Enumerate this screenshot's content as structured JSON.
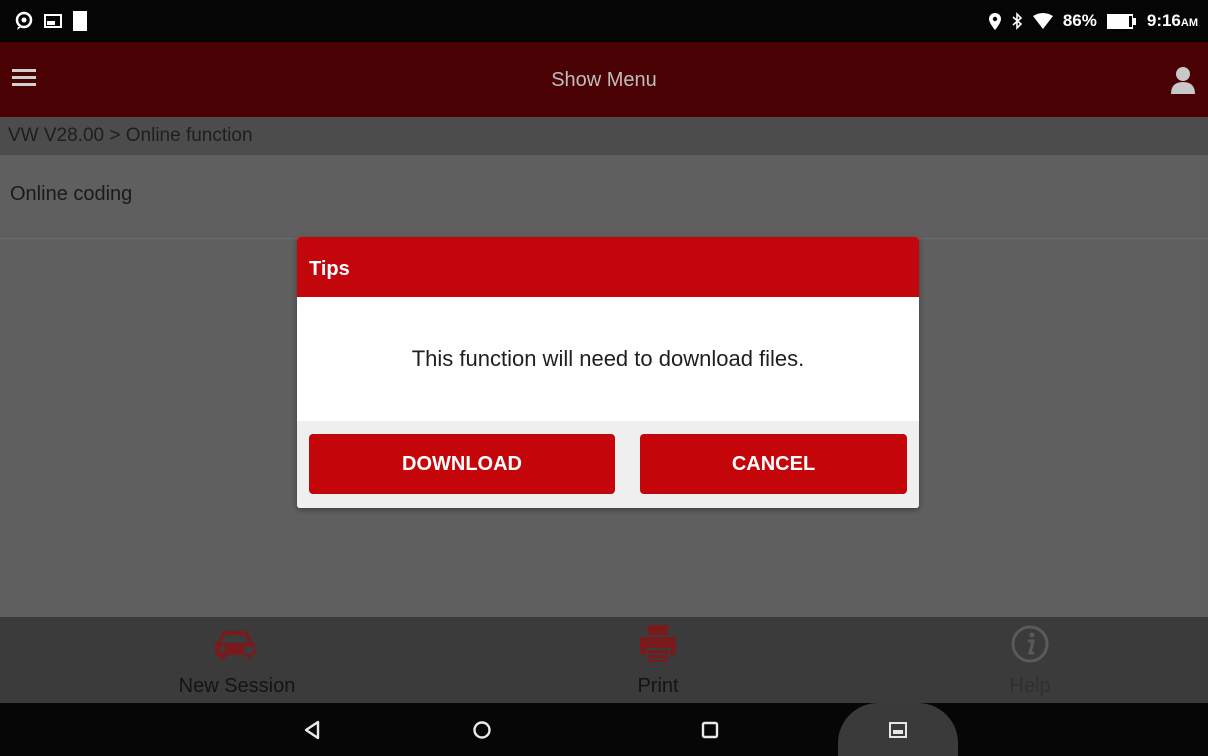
{
  "status_bar": {
    "battery": "86%",
    "time": "9:16",
    "ampm": "AM"
  },
  "app_bar": {
    "title": "Show Menu"
  },
  "breadcrumb": "VW V28.00 > Online function",
  "content": {
    "items": [
      {
        "label": "Online coding"
      }
    ]
  },
  "dialog": {
    "title": "Tips",
    "message": "This function will need to download files.",
    "download_label": "DOWNLOAD",
    "cancel_label": "CANCEL"
  },
  "toolbar": {
    "new_session_label": "New Session",
    "print_label": "Print",
    "help_label": "Help"
  },
  "colors": {
    "accent_red": "#c3070d",
    "app_bar": "#4a0103",
    "dim_icon_red": "#7a1a1c"
  }
}
